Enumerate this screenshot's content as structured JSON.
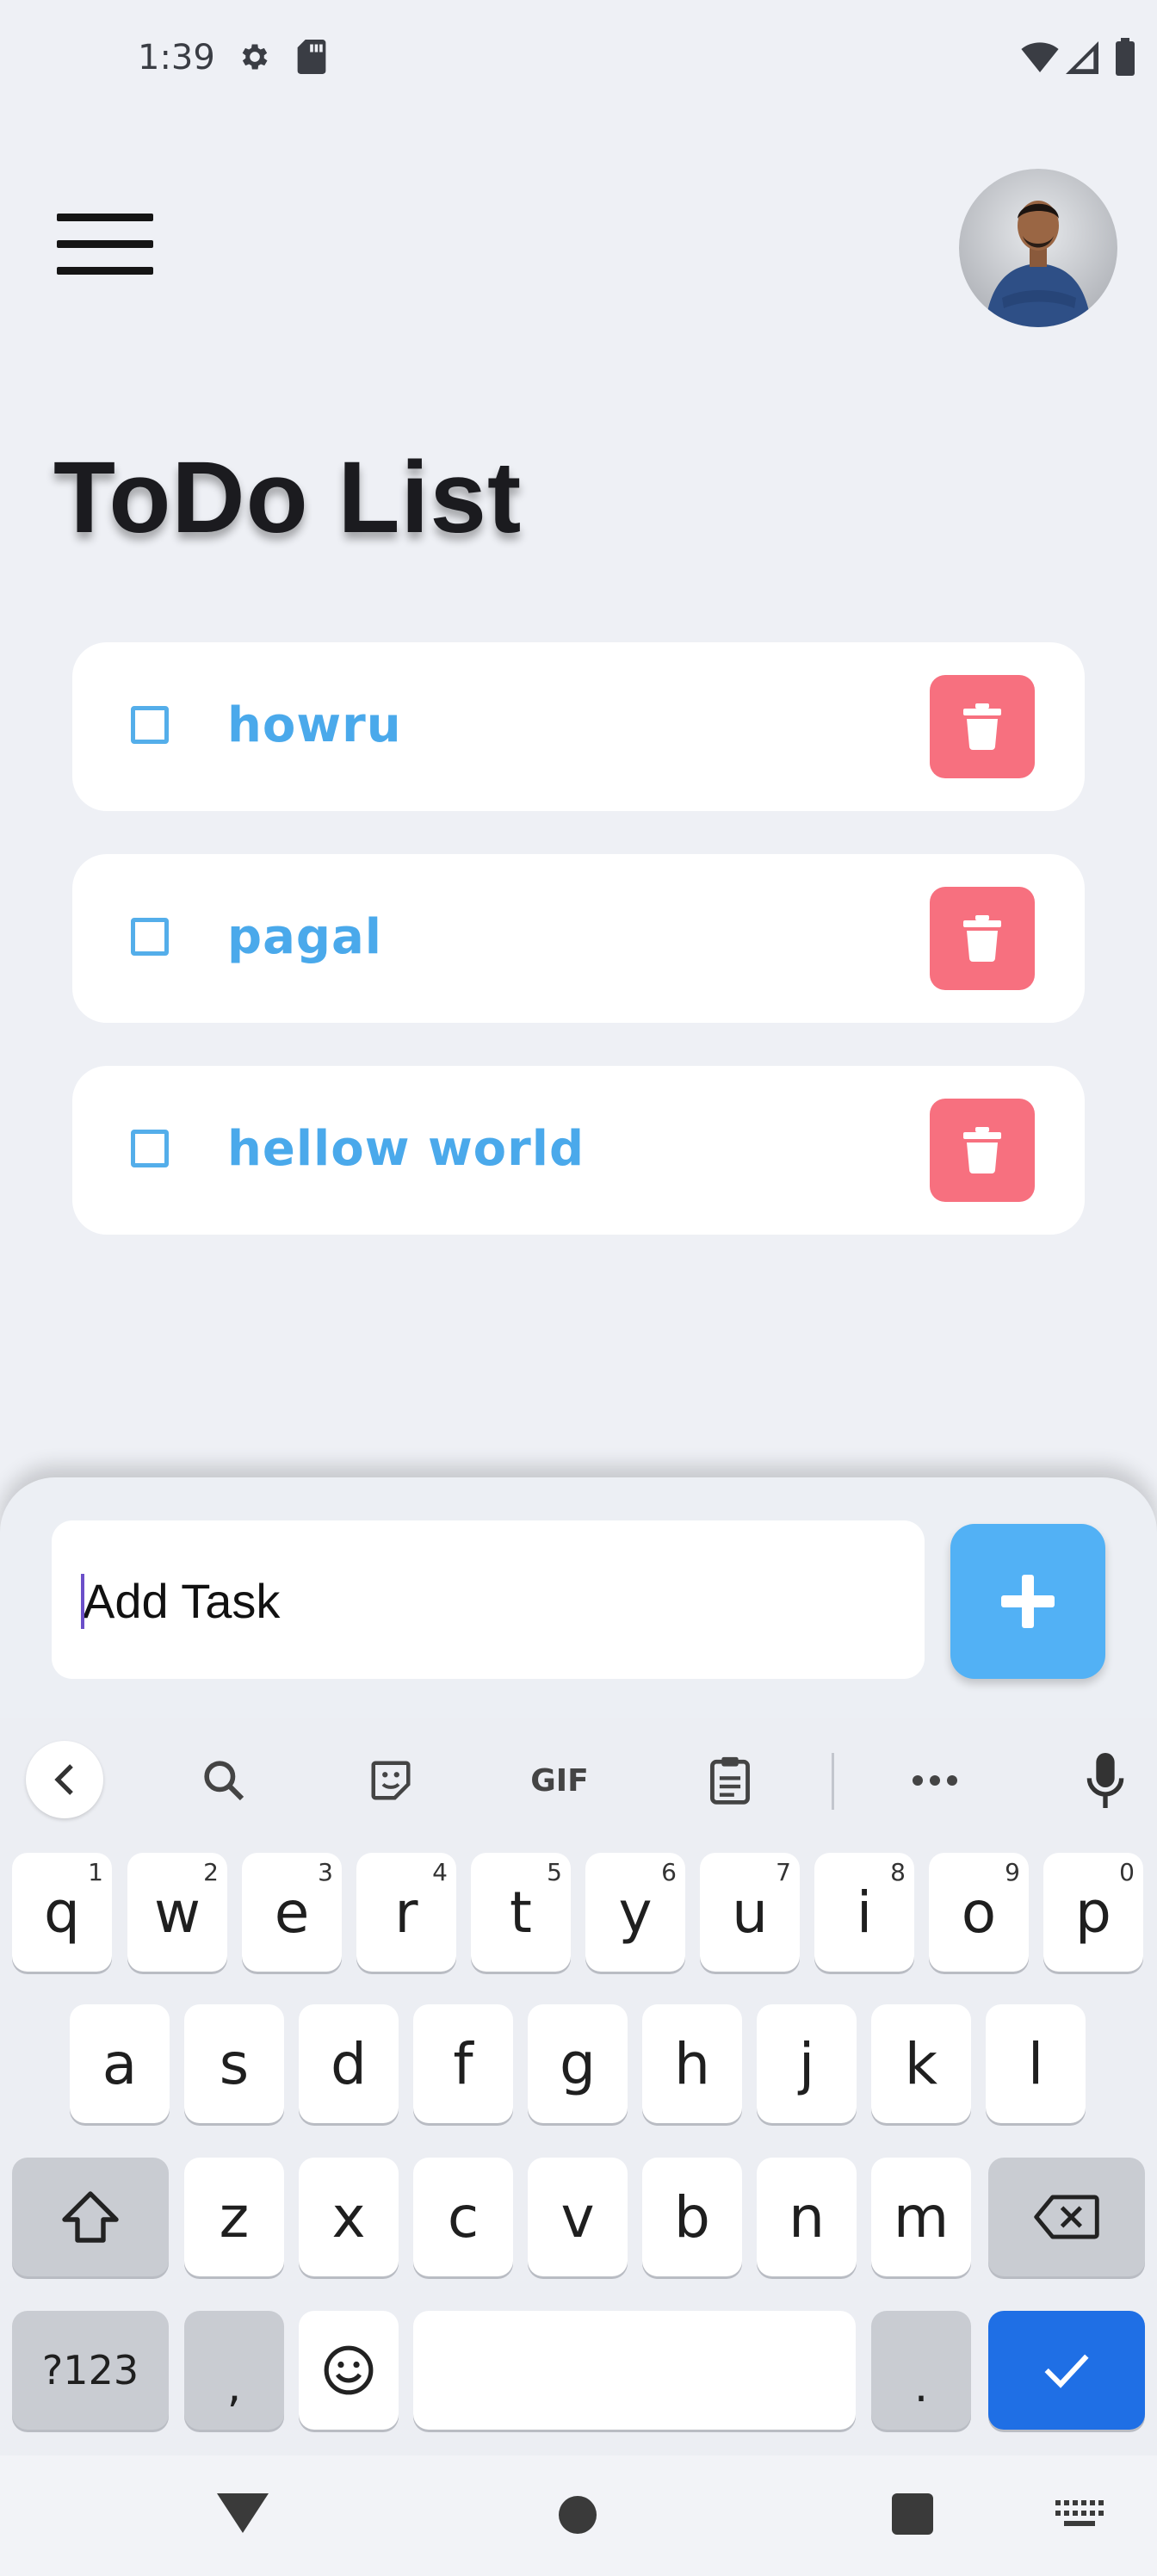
{
  "status_bar": {
    "time": "1:39"
  },
  "header": {
    "title": "ToDo List"
  },
  "todos": [
    {
      "label": "howru",
      "checked": false
    },
    {
      "label": "pagal",
      "checked": false
    },
    {
      "label": "hellow world",
      "checked": false
    }
  ],
  "task_input": {
    "placeholder": "Add Task",
    "value": ""
  },
  "keyboard": {
    "toolbar": {
      "gif_label": "GIF"
    },
    "row1": [
      {
        "key": "q",
        "hint": "1"
      },
      {
        "key": "w",
        "hint": "2"
      },
      {
        "key": "e",
        "hint": "3"
      },
      {
        "key": "r",
        "hint": "4"
      },
      {
        "key": "t",
        "hint": "5"
      },
      {
        "key": "y",
        "hint": "6"
      },
      {
        "key": "u",
        "hint": "7"
      },
      {
        "key": "i",
        "hint": "8"
      },
      {
        "key": "o",
        "hint": "9"
      },
      {
        "key": "p",
        "hint": "0"
      }
    ],
    "row2": [
      "a",
      "s",
      "d",
      "f",
      "g",
      "h",
      "j",
      "k",
      "l"
    ],
    "row3": [
      "z",
      "x",
      "c",
      "v",
      "b",
      "n",
      "m"
    ],
    "bottom": {
      "symbols": "?123",
      "comma": ",",
      "period": "."
    }
  },
  "colors": {
    "accent_blue": "#52b1f5",
    "delete_red": "#f7707f",
    "todo_text": "#4aa9eb",
    "keyboard_action": "#1f6fe5"
  }
}
